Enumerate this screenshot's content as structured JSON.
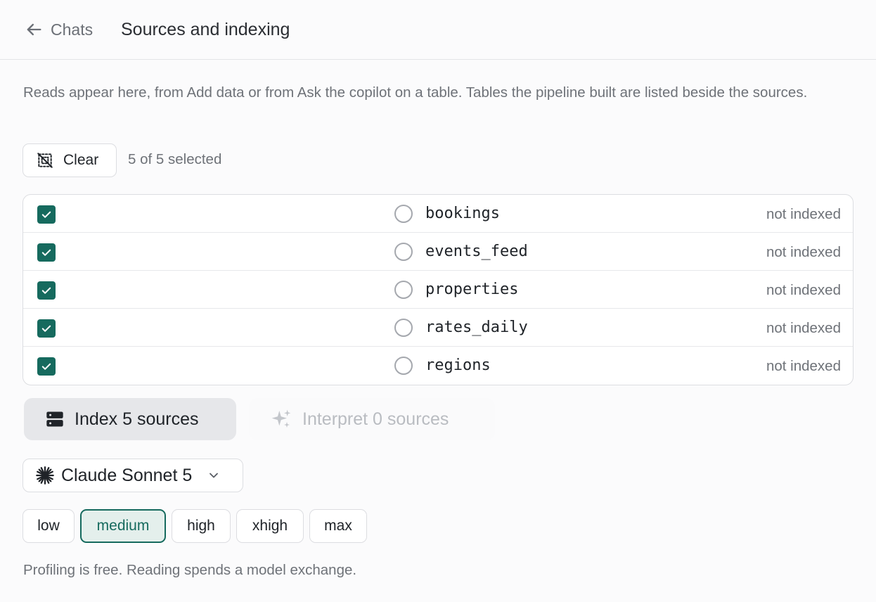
{
  "header": {
    "back_label": "Chats",
    "title": "Sources and indexing"
  },
  "description": "Reads appear here, from Add data or from Ask the copilot on a table. Tables the pipeline built are listed beside the sources.",
  "selection": {
    "clear_label": "Clear",
    "count_text": "5 of 5 selected"
  },
  "sources": [
    {
      "name": "bookings",
      "status": "not indexed",
      "checked": true
    },
    {
      "name": "events_feed",
      "status": "not indexed",
      "checked": true
    },
    {
      "name": "properties",
      "status": "not indexed",
      "checked": true
    },
    {
      "name": "rates_daily",
      "status": "not indexed",
      "checked": true
    },
    {
      "name": "regions",
      "status": "not indexed",
      "checked": true
    }
  ],
  "actions": {
    "index_label": "Index 5 sources",
    "interpret_label": "Interpret 0 sources"
  },
  "model": {
    "label": "Claude Sonnet 5"
  },
  "effort": {
    "options": [
      "low",
      "medium",
      "high",
      "xhigh",
      "max"
    ],
    "selected": "medium"
  },
  "footer_note": "Profiling is free. Reading spends a model exchange.",
  "colors": {
    "accent": "#166a5e",
    "accent_bg": "#e4efec",
    "muted_text": "#6e7278"
  },
  "icons": {
    "back": "arrow-left-icon",
    "clear": "deselect-icon",
    "index": "server-icon",
    "interpret": "sparkles-icon",
    "model": "claude-logo-icon",
    "dropdown": "chevron-down-icon"
  }
}
